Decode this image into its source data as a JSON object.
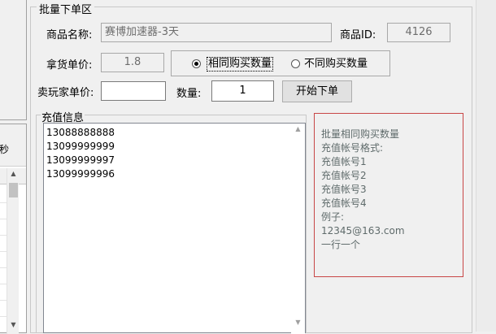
{
  "left_pane": {
    "secs_text": "秒"
  },
  "batch_order": {
    "group_title": "批量下单区",
    "product_name_label": "商品名称:",
    "product_name_value": "赛博加速器-3天",
    "product_id_label": "商品ID:",
    "product_id_value": "4126",
    "wholesale_price_label": "拿货单价:",
    "wholesale_price_value": "1.8",
    "mode_options": [
      {
        "label": "相同购买数量",
        "selected": true
      },
      {
        "label": "不同购买数量",
        "selected": false
      }
    ],
    "seller_price_label": "卖玩家单价:",
    "seller_price_value": "",
    "quantity_label": "数量:",
    "quantity_value": "1",
    "start_button_label": "开始下单"
  },
  "recharge": {
    "group_title": "充值信息",
    "lines": [
      "13088888888",
      "13099999999",
      "13099999997",
      "13099999996"
    ]
  },
  "help": {
    "lines": [
      "批量相同购买数量",
      "充值帐号格式:",
      "充值帐号1",
      "充值帐号2",
      "充值帐号3",
      "充值帐号4",
      "例子:",
      "12345@163.com",
      "一行一个"
    ]
  },
  "icons": {
    "scroll_up": "scroll-up-arrow-icon",
    "scroll_down": "scroll-down-arrow-icon"
  }
}
